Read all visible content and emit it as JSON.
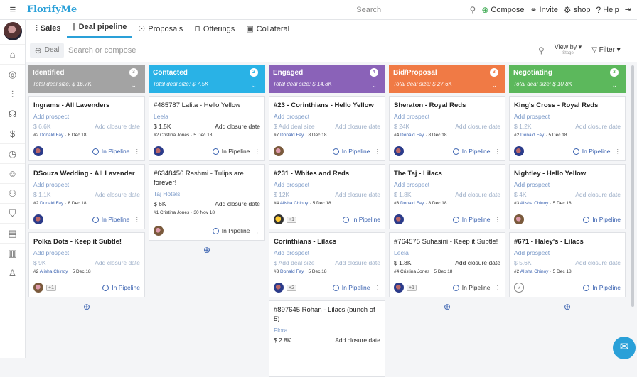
{
  "topbar": {
    "brand": "FlorifyMe",
    "search_label": "Search",
    "compose": "Compose",
    "invite": "Invite",
    "shop": "shop",
    "help": "Help"
  },
  "subnav": {
    "tabs": [
      {
        "label": "Sales",
        "icon": "sales-icon"
      },
      {
        "label": "Deal pipeline",
        "icon": "pipeline-icon"
      },
      {
        "label": "Proposals",
        "icon": "proposals-icon"
      },
      {
        "label": "Offerings",
        "icon": "offerings-icon"
      },
      {
        "label": "Collateral",
        "icon": "collateral-icon"
      }
    ]
  },
  "toolbar": {
    "add_deal": "Deal",
    "search_placeholder": "Search or compose",
    "view_by": "View by",
    "view_by_sub": "Stage",
    "filter": "Filter"
  },
  "columns": [
    {
      "title": "Identified",
      "count": "3",
      "total": "Total deal size: $ 16.7K",
      "color": "#a3a3a3",
      "cards": [
        {
          "title": "Ingrams - All Lavenders",
          "sub": "Add prospect",
          "amount": "$ 6.6K",
          "closure": "Add closure date",
          "num": "#2",
          "who": "Donald Fay",
          "date": "8 Dec 18",
          "status": "In Pipeline"
        },
        {
          "title": "DSouza Wedding - All Lavender",
          "sub": "Add prospect",
          "amount": "$ 1.1K",
          "closure": "Add closure date",
          "num": "#2",
          "who": "Donald Fay",
          "date": "8 Dec 18",
          "status": "In Pipeline"
        },
        {
          "title": "Polka Dots - Keep it Subtle!",
          "sub": "Add prospect",
          "amount": "$ 9K",
          "closure": "Add closure date",
          "num": "#2",
          "who": "Alisha Chinoy",
          "date": "5 Dec 18",
          "status": "In Pipeline",
          "extra": "+1"
        }
      ]
    },
    {
      "title": "Contacted",
      "count": "2",
      "total": "Total deal size: $ 7.5K",
      "color": "#29b2e6",
      "cards": [
        {
          "title": "#485787 Lalita - Hello Yellow",
          "sub": "Leela",
          "amount": "$ 1.5K",
          "closure": "Add closure date",
          "num": "#2",
          "who": "Cristina Jones",
          "date": "5 Dec 18",
          "status": "In Pipeline"
        },
        {
          "title": "#6348456 Rashmi - Tulips are forever!",
          "sub": "Taj Hotels",
          "amount": "$ 6K",
          "closure": "Add closure date",
          "num": "#1",
          "who": "Cristina Jones",
          "date": "30 Nov 18",
          "status": "In Pipeline"
        }
      ]
    },
    {
      "title": "Engaged",
      "count": "4",
      "total": "Total deal size: $ 14.8K",
      "color": "#8a62b8",
      "cards": [
        {
          "title": "#23 - Corinthians - Hello Yellow",
          "sub": "Add prospect",
          "amount": "$ Add deal size",
          "closure": "Add closure date",
          "num": "#7",
          "who": "Donald Fay",
          "date": "8 Dec 18",
          "status": "In Pipeline"
        },
        {
          "title": "#231 - Whites and Reds",
          "sub": "Add prospect",
          "amount": "$ 12K",
          "closure": "Add closure date",
          "num": "#4",
          "who": "Alisha Chinoy",
          "date": "5 Dec 18",
          "status": "In Pipeline",
          "extra": "+1"
        },
        {
          "title": "Corinthians - Lilacs",
          "sub": "Add prospect",
          "amount": "$ Add deal size",
          "closure": "Add closure date",
          "num": "#3",
          "who": "Donald Fay",
          "date": "5 Dec 18",
          "status": "In Pipeline",
          "extra": "+2"
        },
        {
          "title": "#897645 Rohan - Lilacs (bunch of 5)",
          "sub": "Flora",
          "amount": "$ 2.8K",
          "closure": "Add closure date"
        }
      ]
    },
    {
      "title": "Bid/Proposal",
      "count": "3",
      "total": "Total deal size: $ 27.6K",
      "color": "#f07a45",
      "cards": [
        {
          "title": "Sheraton - Royal Reds",
          "sub": "Add prospect",
          "amount": "$ 24K",
          "closure": "Add closure date",
          "num": "#4",
          "who": "Donald Fay",
          "date": "8 Dec 18",
          "status": "In Pipeline"
        },
        {
          "title": "The Taj - Lilacs",
          "sub": "Add prospect",
          "amount": "$ 1.8K",
          "closure": "Add closure date",
          "num": "#3",
          "who": "Donald Fay",
          "date": "8 Dec 18",
          "status": "In Pipeline"
        },
        {
          "title": "#764575 Suhasini - Keep it Subtle!",
          "sub": "Leela",
          "amount": "$ 1.8K",
          "closure": "Add closure date",
          "num": "#4",
          "who": "Cristina Jones",
          "date": "5 Dec 18",
          "status": "In Pipeline",
          "extra": "+1"
        }
      ]
    },
    {
      "title": "Negotiating",
      "count": "3",
      "total": "Total deal size: $ 10.8K",
      "color": "#5cb85c",
      "cards": [
        {
          "title": "King's Cross - Royal Reds",
          "sub": "Add prospect",
          "amount": "$ 1.2K",
          "closure": "Add closure date",
          "num": "#2",
          "who": "Donald Fay",
          "date": "5 Dec 18",
          "status": "In Pipeline"
        },
        {
          "title": "Nightley - Hello Yellow",
          "sub": "Add prospect",
          "amount": "$ 4K",
          "closure": "Add closure date",
          "num": "#3",
          "who": "Alisha Chinoy",
          "date": "5 Dec 18",
          "status": "In Pipeline"
        },
        {
          "title": "#671 - Haley's - Lilacs",
          "sub": "Add prospect",
          "amount": "$ 5.6K",
          "closure": "Add closure date",
          "num": "#2",
          "who": "Alisha Chinoy",
          "date": "5 Dec 18",
          "status": "In Pipeline"
        }
      ]
    }
  ]
}
